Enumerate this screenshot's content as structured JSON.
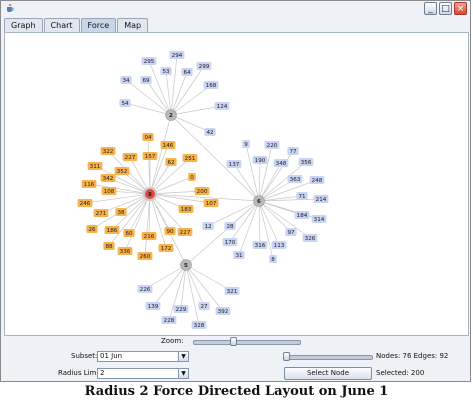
{
  "window": {
    "minimize_glyph": "_",
    "maximize_glyph": "□",
    "close_glyph": "×",
    "app_icon": "java-cup-icon"
  },
  "tabs": [
    {
      "label": "Graph"
    },
    {
      "label": "Chart"
    },
    {
      "label": "Force",
      "active": true
    },
    {
      "label": "Map"
    }
  ],
  "colors": {
    "hub_gray": "#b9b9b9",
    "orange_node": "#f7b24c",
    "blue_node": "#c9d3f3",
    "center_node": "#e24a3b",
    "edge": "#c7c7c7"
  },
  "graph": {
    "hubs": [
      {
        "id": "8",
        "color": "center"
      },
      {
        "id": "2",
        "color": "gray"
      },
      {
        "id": "6",
        "color": "gray"
      },
      {
        "id": "5",
        "color": "gray"
      }
    ],
    "nodes": [
      {
        "label": "294",
        "c": "blue"
      },
      {
        "label": "295",
        "c": "blue"
      },
      {
        "label": "53",
        "c": "blue"
      },
      {
        "label": "64",
        "c": "blue"
      },
      {
        "label": "299",
        "c": "blue"
      },
      {
        "label": "34",
        "c": "blue"
      },
      {
        "label": "69",
        "c": "blue"
      },
      {
        "label": "168",
        "c": "blue"
      },
      {
        "label": "54",
        "c": "blue"
      },
      {
        "label": "124",
        "c": "blue"
      },
      {
        "label": "42",
        "c": "blue"
      },
      {
        "label": "9",
        "c": "blue"
      },
      {
        "label": "220",
        "c": "blue"
      },
      {
        "label": "77",
        "c": "blue"
      },
      {
        "label": "190",
        "c": "blue"
      },
      {
        "label": "348",
        "c": "blue"
      },
      {
        "label": "356",
        "c": "blue"
      },
      {
        "label": "363",
        "c": "blue"
      },
      {
        "label": "248",
        "c": "blue"
      },
      {
        "label": "137",
        "c": "blue"
      },
      {
        "label": "71",
        "c": "blue"
      },
      {
        "label": "214",
        "c": "blue"
      },
      {
        "label": "184",
        "c": "blue"
      },
      {
        "label": "314",
        "c": "blue"
      },
      {
        "label": "97",
        "c": "blue"
      },
      {
        "label": "326",
        "c": "blue"
      },
      {
        "label": "28",
        "c": "blue"
      },
      {
        "label": "170",
        "c": "blue"
      },
      {
        "label": "316",
        "c": "blue"
      },
      {
        "label": "113",
        "c": "blue"
      },
      {
        "label": "12",
        "c": "blue"
      },
      {
        "label": "31",
        "c": "blue"
      },
      {
        "label": "8",
        "c": "blue"
      },
      {
        "label": "226",
        "c": "blue"
      },
      {
        "label": "321",
        "c": "blue"
      },
      {
        "label": "139",
        "c": "blue"
      },
      {
        "label": "229",
        "c": "blue"
      },
      {
        "label": "27",
        "c": "blue"
      },
      {
        "label": "392",
        "c": "blue"
      },
      {
        "label": "228",
        "c": "blue"
      },
      {
        "label": "328",
        "c": "blue"
      },
      {
        "label": "04",
        "c": "orange"
      },
      {
        "label": "146",
        "c": "orange"
      },
      {
        "label": "322",
        "c": "orange"
      },
      {
        "label": "227",
        "c": "orange"
      },
      {
        "label": "157",
        "c": "orange"
      },
      {
        "label": "311",
        "c": "orange"
      },
      {
        "label": "352",
        "c": "orange"
      },
      {
        "label": "62",
        "c": "orange"
      },
      {
        "label": "251",
        "c": "orange"
      },
      {
        "label": "342",
        "c": "orange"
      },
      {
        "label": "0",
        "c": "orange"
      },
      {
        "label": "116",
        "c": "orange"
      },
      {
        "label": "108",
        "c": "orange"
      },
      {
        "label": "200",
        "c": "orange"
      },
      {
        "label": "246",
        "c": "orange"
      },
      {
        "label": "107",
        "c": "orange"
      },
      {
        "label": "271",
        "c": "orange"
      },
      {
        "label": "38",
        "c": "orange"
      },
      {
        "label": "183",
        "c": "orange"
      },
      {
        "label": "26",
        "c": "orange"
      },
      {
        "label": "186",
        "c": "orange"
      },
      {
        "label": "60",
        "c": "orange"
      },
      {
        "label": "216",
        "c": "orange"
      },
      {
        "label": "90",
        "c": "orange"
      },
      {
        "label": "227",
        "c": "orange"
      },
      {
        "label": "88",
        "c": "orange"
      },
      {
        "label": "336",
        "c": "orange"
      },
      {
        "label": "260",
        "c": "orange"
      },
      {
        "label": "172",
        "c": "orange"
      }
    ]
  },
  "controls": {
    "zoom_label": "Zoom:",
    "subset_label": "Subset:",
    "subset_value": "01 Jun",
    "radius_label": "Radius Limit:",
    "radius_value": "2",
    "nodes_edges": "Nodes: 76 Edges: 92",
    "select_node_button": "Select Node",
    "selected_text": "Selected: 200"
  },
  "caption": "Radius 2 Force Directed Layout on June 1"
}
